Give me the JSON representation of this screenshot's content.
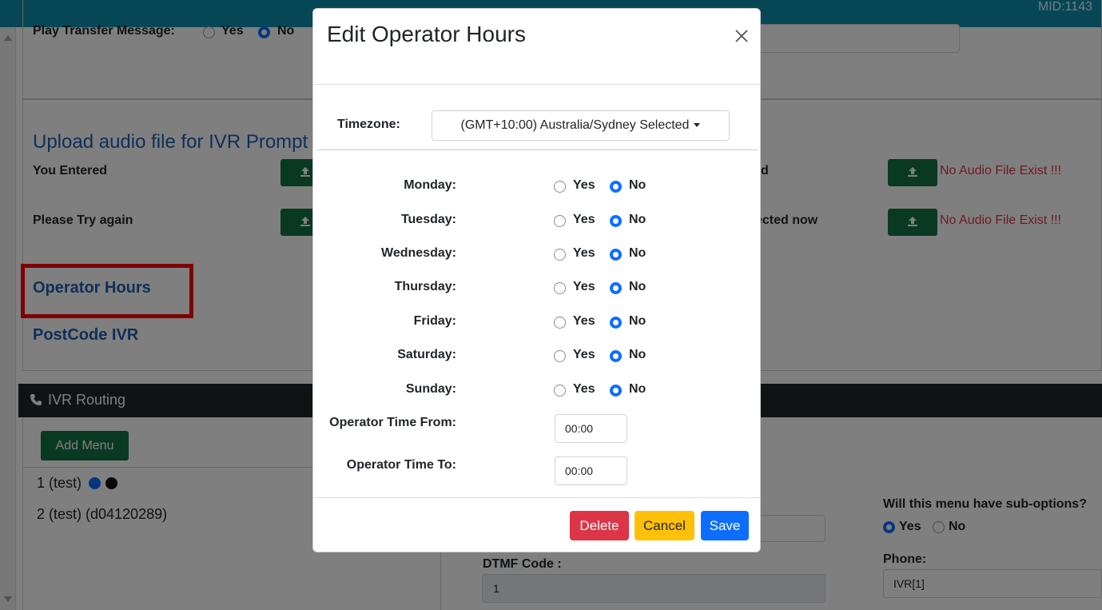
{
  "app": {
    "mid_label": "MID:1143"
  },
  "background": {
    "play_transfer": {
      "label": "Play Transfer Message:",
      "yes": "Yes",
      "no": "No",
      "selected": "No"
    },
    "upload_title": "Upload audio file for IVR Prompt",
    "prompts": [
      {
        "label": "You Entered",
        "right_label": "d",
        "status": "No Audio File Exist !!!"
      },
      {
        "label": "Please Try again",
        "right_label": "ected now",
        "status": "No Audio File Exist !!!"
      }
    ],
    "links": {
      "operator_hours": "Operator Hours",
      "postcode_ivr": "PostCode IVR"
    },
    "routing": {
      "title": "IVR Routing",
      "add_menu": "Add Menu",
      "menu_items": [
        "1 (test)",
        "2 (test) (d04120289)"
      ],
      "sub_options_label": "Will this menu have sub-options?",
      "sub_yes": "Yes",
      "sub_no": "No",
      "sub_selected": "Yes",
      "dtmf_label": "DTMF Code :",
      "dtmf_value": "1",
      "phone_label": "Phone:",
      "phone_value": "IVR[1]"
    }
  },
  "modal": {
    "title": "Edit Operator Hours",
    "timezone_label": "Timezone:",
    "timezone_value": "(GMT+10:00) Australia/Sydney Selected",
    "yes": "Yes",
    "no": "No",
    "days": [
      {
        "label": "Monday:",
        "selected": "No"
      },
      {
        "label": "Tuesday:",
        "selected": "No"
      },
      {
        "label": "Wednesday:",
        "selected": "No"
      },
      {
        "label": "Thursday:",
        "selected": "No"
      },
      {
        "label": "Friday:",
        "selected": "No"
      },
      {
        "label": "Saturday:",
        "selected": "No"
      },
      {
        "label": "Sunday:",
        "selected": "No"
      }
    ],
    "time_from_label": "Operator Time From:",
    "time_from_value": "00:00",
    "time_to_label": "Operator Time To:",
    "time_to_value": "00:00",
    "buttons": {
      "delete": "Delete",
      "cancel": "Cancel",
      "save": "Save"
    }
  },
  "colors": {
    "accent": "#0d6efd",
    "danger": "#dc3545",
    "warning": "#ffc107",
    "success": "#157347",
    "link": "#1e5eb5",
    "highlight": "#ff0000"
  }
}
